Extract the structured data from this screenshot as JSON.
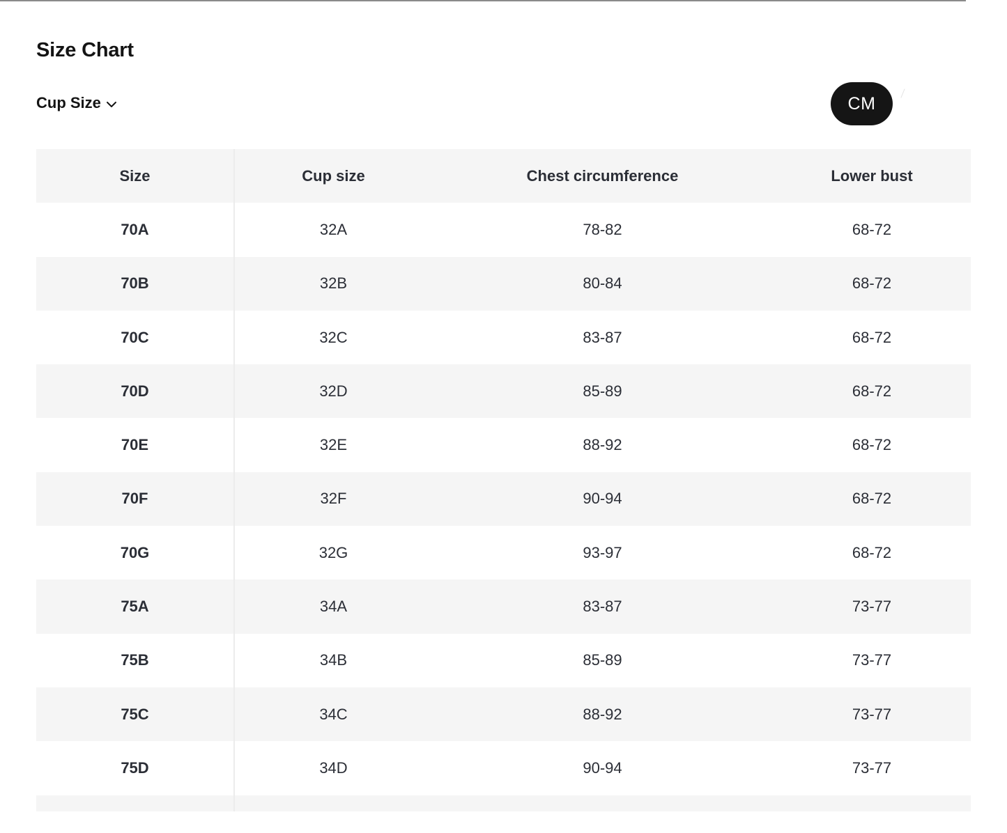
{
  "page": {
    "title": "Size Chart"
  },
  "controls": {
    "size_type_label": "Cup Size",
    "unit_label": "CM"
  },
  "table": {
    "columns": [
      "Size",
      "Cup size",
      "Chest circumference",
      "Lower bust"
    ],
    "rows": [
      [
        "70A",
        "32A",
        "78-82",
        "68-72"
      ],
      [
        "70B",
        "32B",
        "80-84",
        "68-72"
      ],
      [
        "70C",
        "32C",
        "83-87",
        "68-72"
      ],
      [
        "70D",
        "32D",
        "85-89",
        "68-72"
      ],
      [
        "70E",
        "32E",
        "88-92",
        "68-72"
      ],
      [
        "70F",
        "32F",
        "90-94",
        "68-72"
      ],
      [
        "70G",
        "32G",
        "93-97",
        "68-72"
      ],
      [
        "75A",
        "34A",
        "83-87",
        "73-77"
      ],
      [
        "75B",
        "34B",
        "85-89",
        "73-77"
      ],
      [
        "75C",
        "34C",
        "88-92",
        "73-77"
      ],
      [
        "75D",
        "34D",
        "90-94",
        "73-77"
      ],
      [
        "",
        "",
        "",
        ""
      ]
    ]
  },
  "colors": {
    "accent_dark": "#151515",
    "stripe": "#f5f5f5",
    "text": "#2b2e36"
  }
}
